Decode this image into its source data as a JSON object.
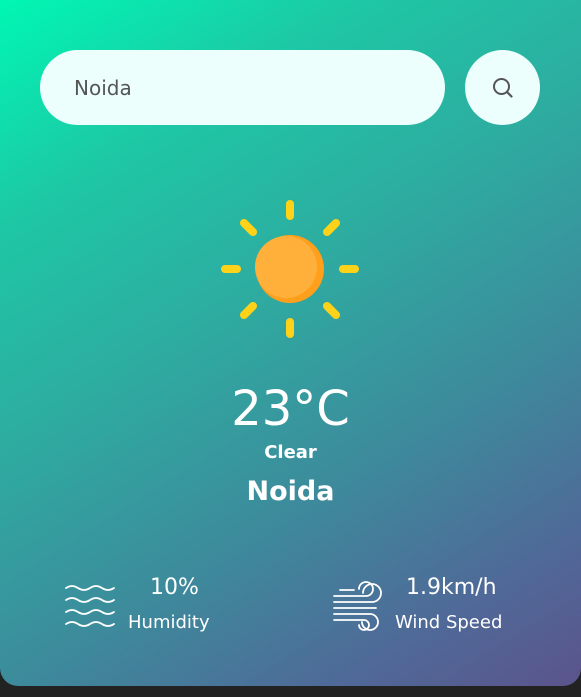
{
  "search": {
    "value": "Noida",
    "icon": "search-icon"
  },
  "weather": {
    "icon": "sun-icon",
    "temperature": "23°C",
    "condition": "Clear",
    "city": "Noida"
  },
  "details": {
    "humidity": {
      "value": "10%",
      "label": "Humidity",
      "icon": "humidity-icon"
    },
    "wind": {
      "value": "1.9km/h",
      "label": "Wind Speed",
      "icon": "wind-icon"
    }
  },
  "colors": {
    "gradient_start": "#00f7b4",
    "gradient_end": "#5b548c",
    "field_background": "#ecfffd",
    "sun_rays": "#ffd21a",
    "sun_body": "#ffb03b"
  }
}
